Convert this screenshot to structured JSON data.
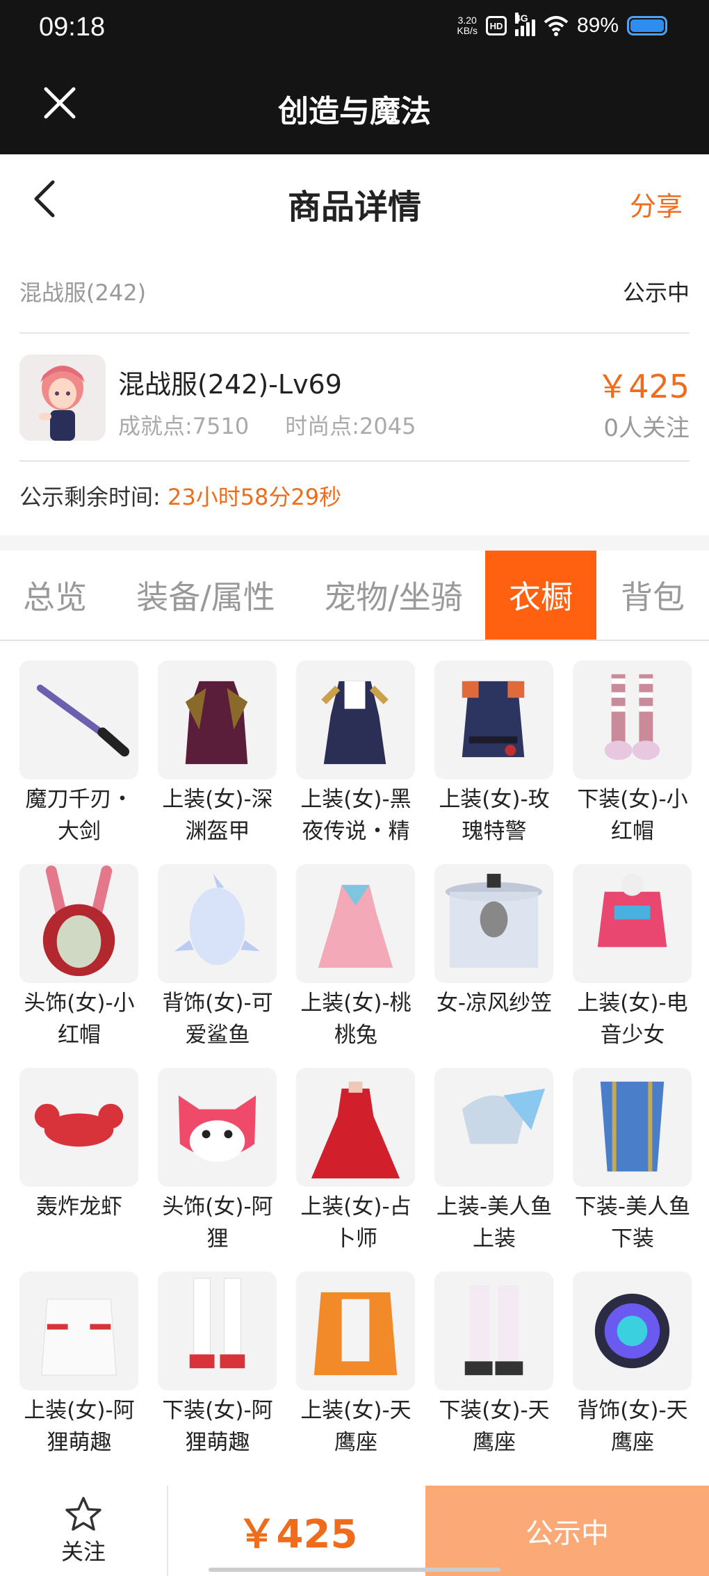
{
  "status_bar": {
    "time": "09:18",
    "speed_value": "3.20",
    "speed_unit": "KB/s",
    "hd": "HD",
    "network": "4G",
    "battery": "89%"
  },
  "app_bar": {
    "title": "创造与魔法"
  },
  "detail_header": {
    "title": "商品详情",
    "share": "分享"
  },
  "server": {
    "name": "混战服(242)",
    "status": "公示中"
  },
  "product": {
    "name": "混战服(242)-Lv69",
    "achievement": "成就点:7510",
    "fashion": "时尚点:2045",
    "price": "￥425",
    "followers": "0人关注"
  },
  "countdown": {
    "label": "公示剩余时间:",
    "value": "23小时58分29秒"
  },
  "tabs": [
    {
      "label": "总览",
      "active": false
    },
    {
      "label": "装备/属性",
      "active": false
    },
    {
      "label": "宠物/坐骑",
      "active": false
    },
    {
      "label": "衣橱",
      "active": true
    },
    {
      "label": "背包",
      "active": false
    }
  ],
  "wardrobe": [
    {
      "label": "魔刀千刃・大剑",
      "icon": "sword"
    },
    {
      "label": "上装(女)-深渊盔甲",
      "icon": "dark-armor"
    },
    {
      "label": "上装(女)-黑夜传说・精",
      "icon": "night-dress"
    },
    {
      "label": "上装(女)-玫瑰特警",
      "icon": "police-uniform"
    },
    {
      "label": "下装(女)-小红帽",
      "icon": "striped-boots"
    },
    {
      "label": "头饰(女)-小红帽",
      "icon": "red-hood"
    },
    {
      "label": "背饰(女)-可爱鲨鱼",
      "icon": "shark"
    },
    {
      "label": "上装(女)-桃桃兔",
      "icon": "pink-dress"
    },
    {
      "label": "女-凉风纱笠",
      "icon": "veil-hat"
    },
    {
      "label": "上装(女)-电音少女",
      "icon": "pink-jacket"
    },
    {
      "label": "轰炸龙虾",
      "icon": "lobster"
    },
    {
      "label": "头饰(女)-阿狸",
      "icon": "fox-head"
    },
    {
      "label": "上装(女)-占卜师",
      "icon": "red-gown"
    },
    {
      "label": "上装-美人鱼上装",
      "icon": "mermaid-top"
    },
    {
      "label": "下装-美人鱼下装",
      "icon": "mermaid-bottom"
    },
    {
      "label": "上装(女)-阿狸萌趣",
      "icon": "white-hoodie"
    },
    {
      "label": "下装(女)-阿狸萌趣",
      "icon": "white-boots"
    },
    {
      "label": "上装(女)-天鹰座",
      "icon": "orange-jacket"
    },
    {
      "label": "下装(女)-天鹰座",
      "icon": "tech-pants"
    },
    {
      "label": "背饰(女)-天鹰座",
      "icon": "tech-orb"
    }
  ],
  "bottom_bar": {
    "follow_label": "关注",
    "price": "￥425",
    "status": "公示中"
  },
  "colors": {
    "accent": "#ef6c1c",
    "tab_active": "#ff6111",
    "status_button": "#fbaa77",
    "dark_bar": "#141414"
  }
}
